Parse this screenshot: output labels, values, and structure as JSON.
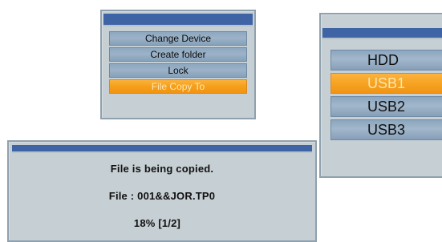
{
  "menu": {
    "items": [
      {
        "label": "Change Device"
      },
      {
        "label": "Create folder"
      },
      {
        "label": "Lock"
      },
      {
        "label": "File Copy To"
      }
    ],
    "selected_index": 3
  },
  "device_list": {
    "items": [
      {
        "label": "HDD"
      },
      {
        "label": "USB1"
      },
      {
        "label": "USB2"
      },
      {
        "label": "USB3"
      }
    ],
    "selected_index": 1
  },
  "copy_dialog": {
    "status": "File is being copied.",
    "file_line": "File : 001&&JOR.TP0",
    "progress_text": "18% [1/2]",
    "progress_percent": 18,
    "file_index": 1,
    "file_total": 2
  },
  "colors": {
    "titlebar": "#3f64a6",
    "panel_bg": "#c6cfd3",
    "item_bg": "#9cb3c8",
    "selected_bg": "#f59f1a"
  }
}
